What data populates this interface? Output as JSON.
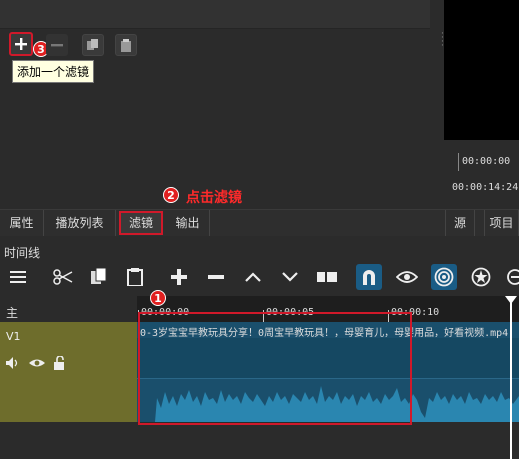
{
  "filters": {
    "add_tooltip": "添加一个滤镜"
  },
  "preview": {
    "position": "00:00:00",
    "duration": "00:00:14:24"
  },
  "annotations": {
    "step1": "1",
    "step2": "2",
    "step3": "3",
    "step2_text": "点击滤镜"
  },
  "tabs": {
    "properties": "属性",
    "playlist": "播放列表",
    "filters": "滤镜",
    "export": "输出",
    "source": "源",
    "project": "项目"
  },
  "timeline": {
    "label": "时间线",
    "master": "主",
    "track_v1": "V1",
    "ticks": [
      "00:00:00",
      "00:00:05",
      "00:00:10"
    ],
    "clip_title": "0-3岁宝宝早教玩具分享！0周宝早教玩具！，母婴育儿，母婴用品，好看视频.mp4"
  },
  "colors": {
    "accent_red": "#d0192a",
    "track_header": "#6e6d2c",
    "clip_blue": "#1a4f6c",
    "wave": "#2a86b0"
  },
  "icons": [
    "plus-icon",
    "minus-icon",
    "copy-icon",
    "paste-icon",
    "menu-icon",
    "cut-icon",
    "copy-icon",
    "paste-icon",
    "plus-icon",
    "minus-icon",
    "up-icon",
    "down-icon",
    "split-icon",
    "snap-magnet-icon",
    "scrub-eye-icon",
    "ripple-icon",
    "ripple-all-icon"
  ]
}
